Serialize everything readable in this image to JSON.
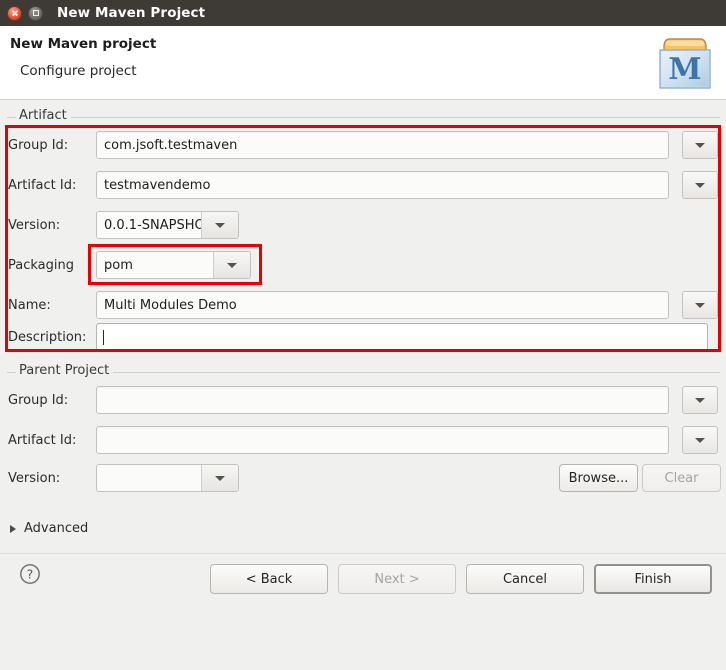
{
  "window": {
    "title": "New Maven Project",
    "close_icon": "close-icon",
    "maximize_icon": "maximize-icon"
  },
  "header": {
    "title": "New Maven project",
    "subtitle": "Configure project",
    "logo_icon": "maven-logo-icon",
    "logo_letter": "M"
  },
  "artifact": {
    "legend": "Artifact",
    "fields": [
      {
        "label": "Group Id:",
        "value": "com.jsoft.testmaven",
        "control": "combo-wide"
      },
      {
        "label": "Artifact Id:",
        "value": "testmavendemo",
        "control": "combo-wide"
      },
      {
        "label": "Version:",
        "value": "0.0.1-SNAPSHO",
        "control": "combo-narrow"
      },
      {
        "label": "Packaging",
        "value": "pom",
        "control": "combo-narrow"
      },
      {
        "label": "Name:",
        "value": "Multi Modules Demo",
        "control": "combo-wide"
      },
      {
        "label": "Description:",
        "value": "",
        "control": "text-focused"
      }
    ]
  },
  "parent_project": {
    "legend": "Parent Project",
    "fields": [
      {
        "label": "Group Id:",
        "value": "",
        "control": "combo-wide"
      },
      {
        "label": "Artifact Id:",
        "value": "",
        "control": "combo-wide"
      },
      {
        "label": "Version:",
        "value": "",
        "control": "combo-narrow"
      }
    ],
    "browse_label": "Browse...",
    "clear_label": "Clear"
  },
  "advanced": {
    "label": "Advanced",
    "expander_icon": "triangle-right-icon"
  },
  "footer": {
    "help_icon": "help-question-icon",
    "buttons": [
      {
        "label": "< Back",
        "state": "enabled"
      },
      {
        "label": "Next >",
        "state": "disabled"
      },
      {
        "label": "Cancel",
        "state": "enabled"
      },
      {
        "label": "Finish",
        "state": "default"
      }
    ]
  },
  "annotations": {
    "highlight_color": "#e60000",
    "artifact_box_label": "artifact-section-highlight",
    "packaging_box_label": "packaging-field-highlight"
  }
}
